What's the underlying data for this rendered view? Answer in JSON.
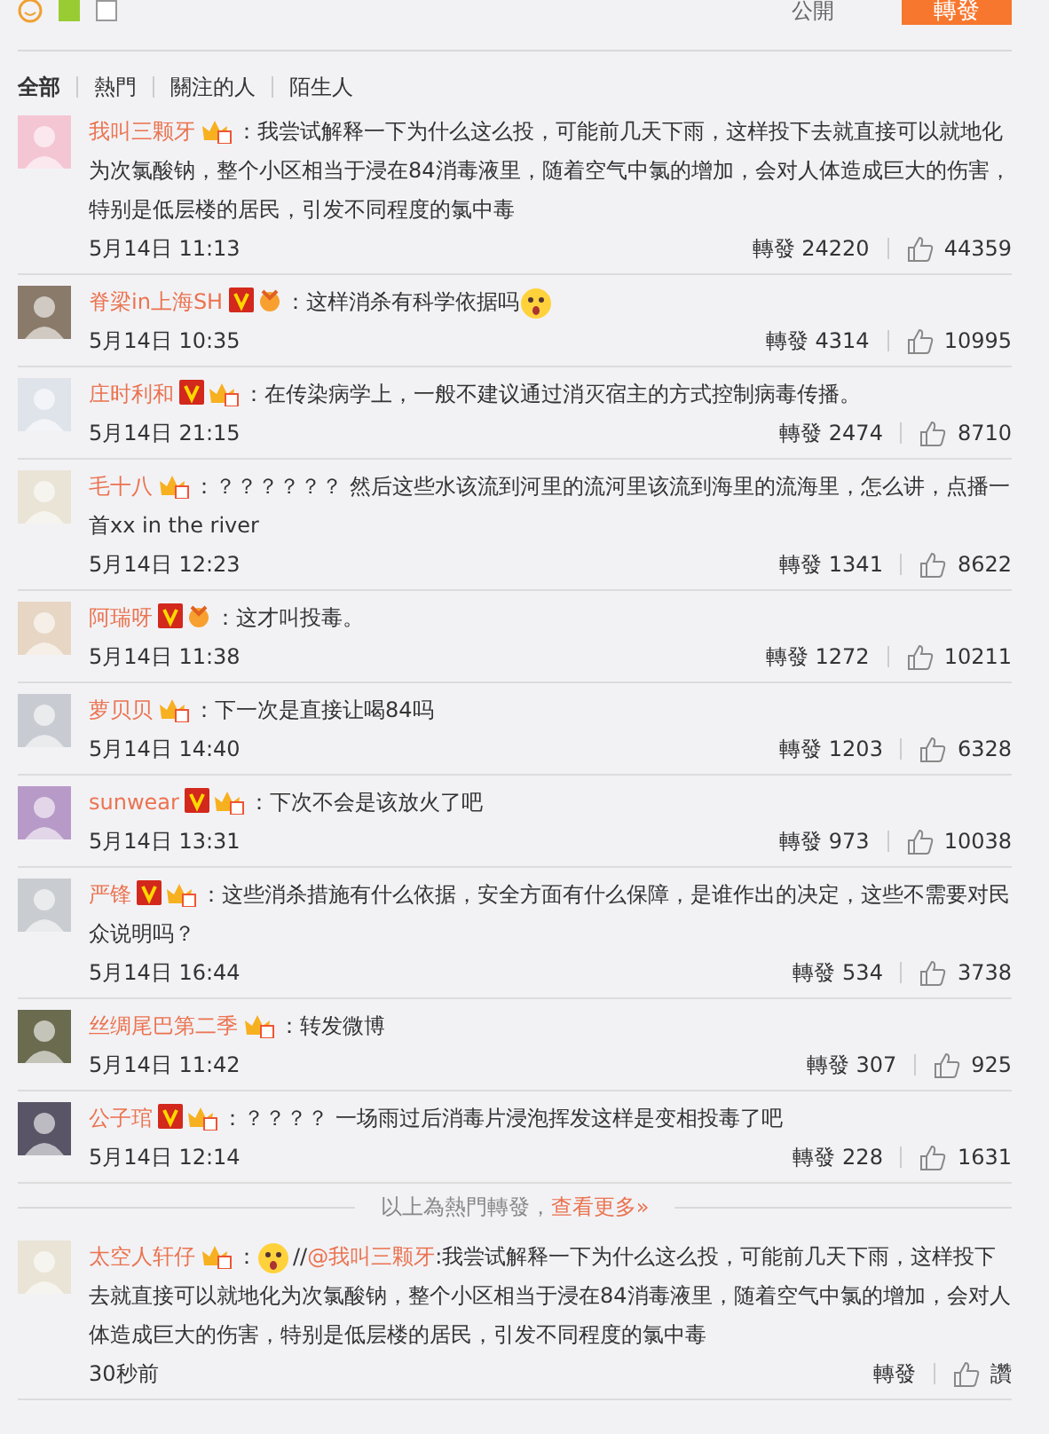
{
  "top_bar": {
    "checked": false,
    "visibility": "公開",
    "submit_button": "轉發"
  },
  "filter_tabs": [
    {
      "label": "全部",
      "selected": true
    },
    {
      "label": "熱門",
      "selected": false
    },
    {
      "label": "關注的人",
      "selected": false
    },
    {
      "label": "陌生人",
      "selected": false
    }
  ],
  "comments": [
    {
      "name": "我叫三颗牙",
      "badges": [
        {
          "kind": "crown"
        }
      ],
      "text": "：我尝试解释一下为什么这么投，可能前几天下雨，这样投下去就直接可以就地化为次氯酸钠，整个小区相当于浸在84消毒液里，随着空气中氯的增加，会对人体造成巨大的伤害，特别是低层楼的居民，引发不同程度的氯中毒",
      "time": "5月14日 11:13",
      "repost": "轉發 24220",
      "likes": "44359"
    },
    {
      "name": "脊梁in上海SH",
      "badges": [
        {
          "kind": "verified"
        },
        {
          "kind": "medal"
        }
      ],
      "text": "：这样消杀有科学依据吗",
      "emoji_after": true,
      "time": "5月14日 10:35",
      "repost": "轉發 4314",
      "likes": "10995"
    },
    {
      "name": "庄时利和",
      "badges": [
        {
          "kind": "verified"
        },
        {
          "kind": "crown"
        }
      ],
      "text": "：在传染病学上，一般不建议通过消灭宿主的方式控制病毒传播。",
      "time": "5月14日 21:15",
      "repost": "轉發 2474",
      "likes": "8710"
    },
    {
      "name": "毛十八",
      "badges": [
        {
          "kind": "crown"
        }
      ],
      "text": "：？？？？？？ 然后这些水该流到河里的流河里该流到海里的流海里，怎么讲，点播一首xx in the river",
      "time": "5月14日 12:23",
      "repost": "轉發 1341",
      "likes": "8622"
    },
    {
      "name": "阿瑞呀",
      "badges": [
        {
          "kind": "verified"
        },
        {
          "kind": "medal"
        }
      ],
      "text": "：这才叫投毒。",
      "time": "5月14日 11:38",
      "repost": "轉發 1272",
      "likes": "10211"
    },
    {
      "name": "萝贝贝",
      "badges": [
        {
          "kind": "crown"
        }
      ],
      "text": "：下一次是直接让喝84吗",
      "time": "5月14日 14:40",
      "repost": "轉發 1203",
      "likes": "6328"
    },
    {
      "name": "sunwear",
      "badges": [
        {
          "kind": "verified"
        },
        {
          "kind": "crown"
        }
      ],
      "text": "：下次不会是该放火了吧",
      "time": "5月14日 13:31",
      "repost": "轉發 973",
      "likes": "10038"
    },
    {
      "name": "严锋",
      "badges": [
        {
          "kind": "verified"
        },
        {
          "kind": "crown"
        }
      ],
      "text": "：这些消杀措施有什么依据，安全方面有什么保障，是谁作出的决定，这些不需要对民众说明吗？",
      "time": "5月14日 16:44",
      "repost": "轉發 534",
      "likes": "3738"
    },
    {
      "name": "丝绸尾巴第二季",
      "badges": [
        {
          "kind": "crown"
        }
      ],
      "text": "：转发微博",
      "time": "5月14日 11:42",
      "repost": "轉發 307",
      "likes": "925"
    },
    {
      "name": "公子琯",
      "badges": [
        {
          "kind": "verified"
        },
        {
          "kind": "crown"
        }
      ],
      "text": "：？？？？ 一场雨过后消毒片浸泡挥发这样是变相投毒了吧",
      "time": "5月14日 12:14",
      "repost": "轉發 228",
      "likes": "1631"
    }
  ],
  "hot_footer": {
    "text": "以上為熱門轉發，",
    "link": "查看更多»"
  },
  "latest": [
    {
      "name": "太空人轩仔",
      "badges": [
        {
          "kind": "crown"
        }
      ],
      "colon": "：",
      "emoji_before": true,
      "quote_prefix": "//",
      "mention": "@我叫三颗牙",
      "text": ":我尝试解释一下为什么这么投，可能前几天下雨，这样投下去就直接可以就地化为次氯酸钠，整个小区相当于浸在84消毒液里，随着空气中氯的增加，会对人体造成巨大的伤害，特别是低层楼的居民，引发不同程度的氯中毒",
      "time": "30秒前",
      "repost": "轉發",
      "likes": "讚"
    }
  ]
}
